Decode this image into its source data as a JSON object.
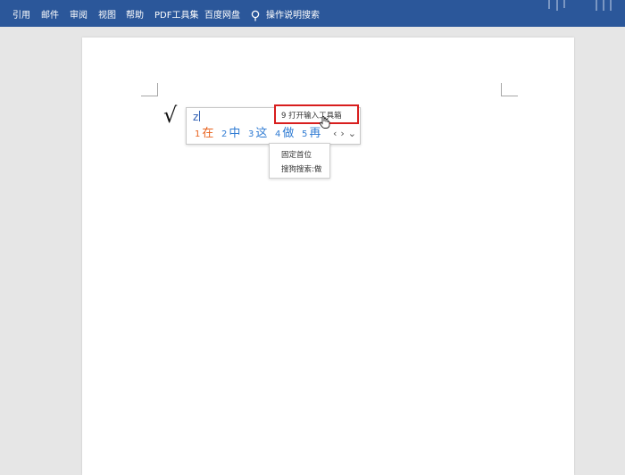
{
  "ribbon": {
    "tabs": [
      "引用",
      "邮件",
      "审阅",
      "视图",
      "帮助",
      "PDF工具集",
      "百度网盘"
    ],
    "tell_me": "操作说明搜索"
  },
  "document": {
    "checkmark": "√"
  },
  "ime": {
    "composition": "z",
    "candidates": [
      {
        "num": "1",
        "text": "在"
      },
      {
        "num": "2",
        "text": "中"
      },
      {
        "num": "3",
        "text": "这"
      },
      {
        "num": "4",
        "text": "做"
      },
      {
        "num": "5",
        "text": "再"
      }
    ],
    "prev": "‹",
    "next": "›",
    "expand": "⌄",
    "tooltip": "9 打开输入工具箱",
    "menu": [
      "固定首位",
      "搜狗搜索:做"
    ]
  },
  "colors": {
    "ribbon": "#2b579a",
    "highlight_box": "#d81e1e",
    "first_candidate": "#e8621d",
    "candidates": "#2f7bd3"
  }
}
